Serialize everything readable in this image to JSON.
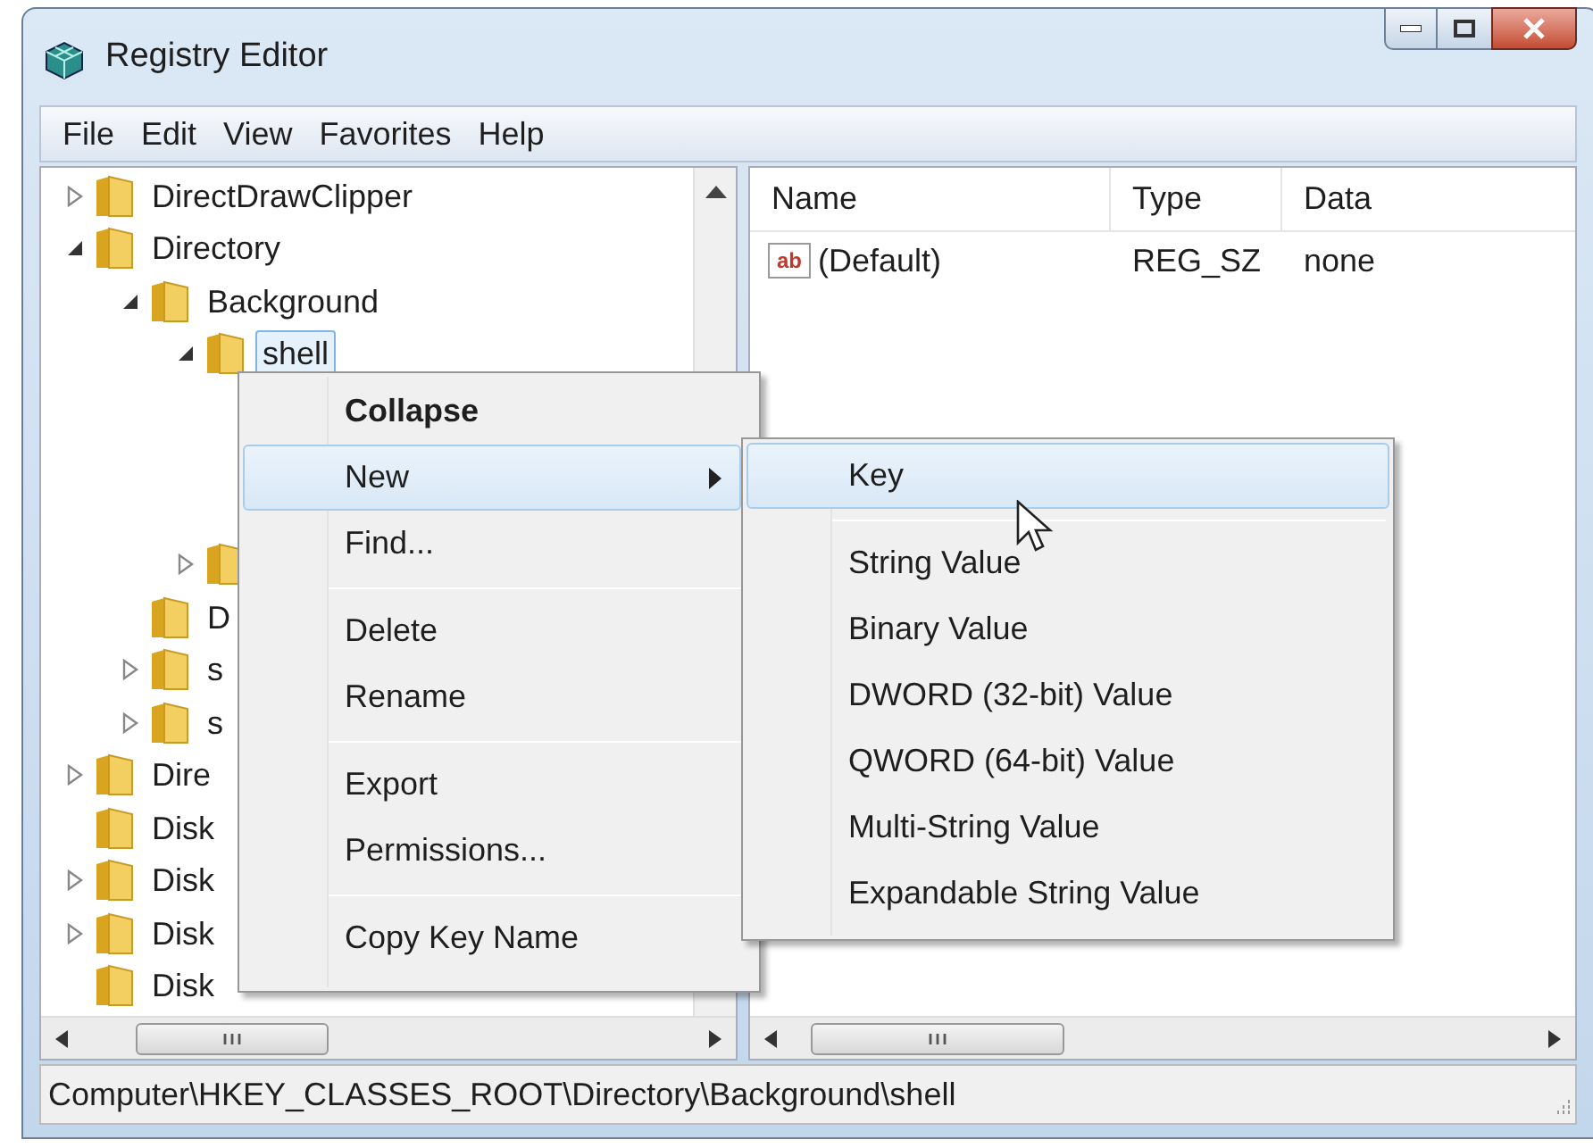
{
  "window": {
    "title": "Registry Editor"
  },
  "menu_bar": [
    {
      "label": "File"
    },
    {
      "label": "Edit"
    },
    {
      "label": "View"
    },
    {
      "label": "Favorites"
    },
    {
      "label": "Help"
    }
  ],
  "tree": [
    {
      "label": "DirectDrawClipper",
      "expanded": false
    },
    {
      "label": "Directory",
      "expanded": true,
      "children": [
        {
          "label": "Background",
          "expanded": true,
          "children": [
            {
              "label": "shell",
              "expanded": true,
              "selected": true
            },
            {
              "expanded": false
            }
          ]
        },
        {
          "label": "D"
        },
        {
          "label": "s",
          "expanded": false
        },
        {
          "label": "s",
          "expanded": false
        }
      ]
    },
    {
      "label": "Dire",
      "expanded": false
    },
    {
      "label": "Disk"
    },
    {
      "label": "Disk",
      "expanded": false
    },
    {
      "label": "Disk",
      "expanded": false
    },
    {
      "label": "Disk"
    }
  ],
  "list": {
    "columns": [
      "Name",
      "Type",
      "Data"
    ],
    "rows": [
      {
        "icon": "ab",
        "name": "(Default)",
        "type": "REG_SZ",
        "data": "none"
      }
    ]
  },
  "context_menu": [
    {
      "kind": "item",
      "label": "Collapse",
      "default": true,
      "selected": false
    },
    {
      "kind": "item",
      "label": "New",
      "selected": true,
      "submenu": true
    },
    {
      "kind": "item",
      "label": "Find...",
      "selected": false
    },
    {
      "kind": "separator"
    },
    {
      "kind": "item",
      "label": "Delete",
      "selected": false
    },
    {
      "kind": "item",
      "label": "Rename",
      "selected": false
    },
    {
      "kind": "separator"
    },
    {
      "kind": "item",
      "label": "Export",
      "selected": false
    },
    {
      "kind": "item",
      "label": "Permissions...",
      "selected": false
    },
    {
      "kind": "separator"
    },
    {
      "kind": "item",
      "label": "Copy Key Name",
      "selected": false
    }
  ],
  "submenu": [
    {
      "kind": "item",
      "label": "Key",
      "selected": true
    },
    {
      "kind": "separator"
    },
    {
      "kind": "item",
      "label": "String Value",
      "selected": false
    },
    {
      "kind": "item",
      "label": "Binary Value",
      "selected": false
    },
    {
      "kind": "item",
      "label": "DWORD (32-bit) Value",
      "selected": false
    },
    {
      "kind": "item",
      "label": "QWORD (64-bit) Value",
      "selected": false
    },
    {
      "kind": "item",
      "label": "Multi-String Value",
      "selected": false
    },
    {
      "kind": "item",
      "label": "Expandable String Value",
      "selected": false
    }
  ],
  "status_bar": "Computer\\HKEY_CLASSES_ROOT\\Directory\\Background\\shell"
}
